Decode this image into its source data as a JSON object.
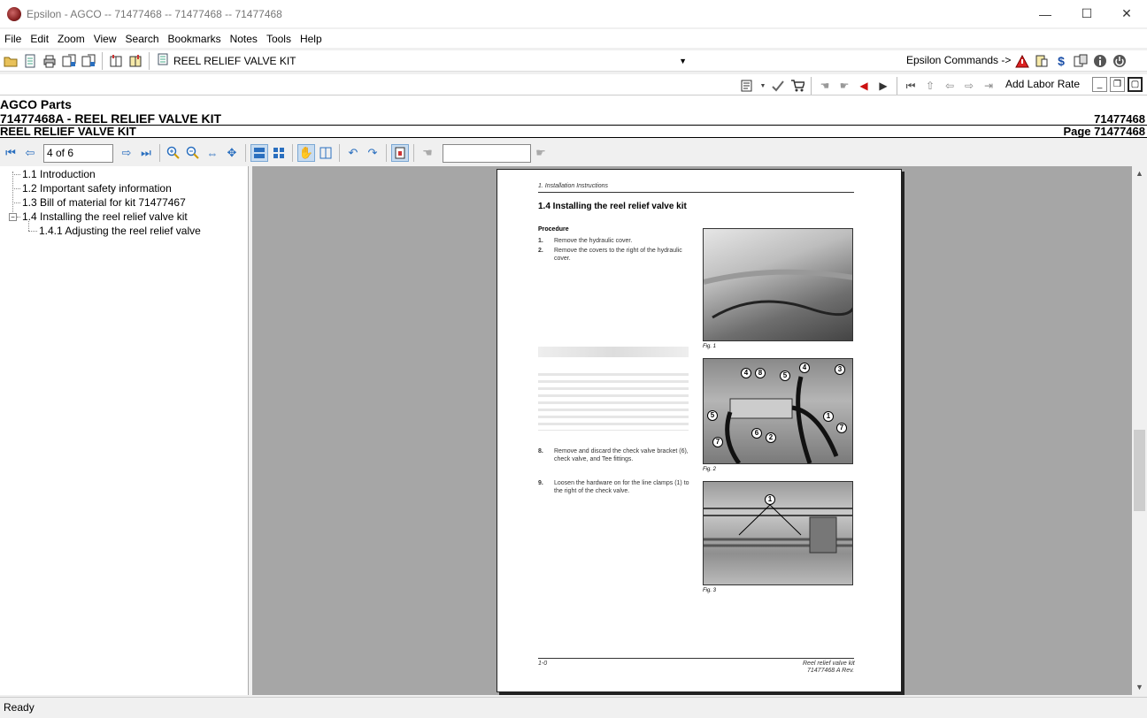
{
  "window": {
    "title": "Epsilon - AGCO -- 71477468 -- 71477468 -- 71477468",
    "minimize": "—",
    "maximize": "☐",
    "close": "✕"
  },
  "menu": [
    "File",
    "Edit",
    "Zoom",
    "View",
    "Search",
    "Bookmarks",
    "Notes",
    "Tools",
    "Help"
  ],
  "toolbar": {
    "document_selector": "REEL RELIEF VALVE KIT",
    "epsilon_commands": "Epsilon Commands ->",
    "add_labor_rate": "Add Labor Rate"
  },
  "header": {
    "brand": "AGCO Parts",
    "part_title": "71477468A - REEL RELIEF VALVE KIT",
    "part_number": "71477468",
    "subtitle": "REEL RELIEF VALVE KIT",
    "page_label": "Page 71477468"
  },
  "nav": {
    "page_indicator": "4 of 6",
    "search_value": ""
  },
  "tree": [
    {
      "label": "1.1 Introduction"
    },
    {
      "label": "1.2 Important safety information"
    },
    {
      "label": "1.3 Bill of material for kit 71477467"
    },
    {
      "label": "1.4 Installing the reel relief valve kit",
      "expanded": true
    },
    {
      "label": "1.4.1 Adjusting the reel relief valve"
    }
  ],
  "document_page": {
    "running_header": "1. Installation Instructions",
    "heading": "1.4   Installing the reel relief valve kit",
    "procedure_label": "Procedure",
    "steps": [
      {
        "num": "1.",
        "text": "Remove the hydraulic cover."
      },
      {
        "num": "2.",
        "text": "Remove the covers to the right of the hydraulic cover."
      },
      {
        "num": "8.",
        "text": "Remove and discard the check valve bracket (6), check valve, and Tee fittings."
      },
      {
        "num": "9.",
        "text": "Loosen the hardware on for the line clamps (1) to the right of the check valve."
      }
    ],
    "figure_captions": [
      "Fig. 1",
      "Fig. 2",
      "Fig. 3"
    ],
    "footer_left": "1-0",
    "footer_right_1": "Reel relief valve kit",
    "footer_right_2": "71477468 A Rev."
  },
  "status": "Ready",
  "colors": {
    "viewer_bg": "#a6a6a6",
    "nav_icon": "#2a6fbf"
  }
}
